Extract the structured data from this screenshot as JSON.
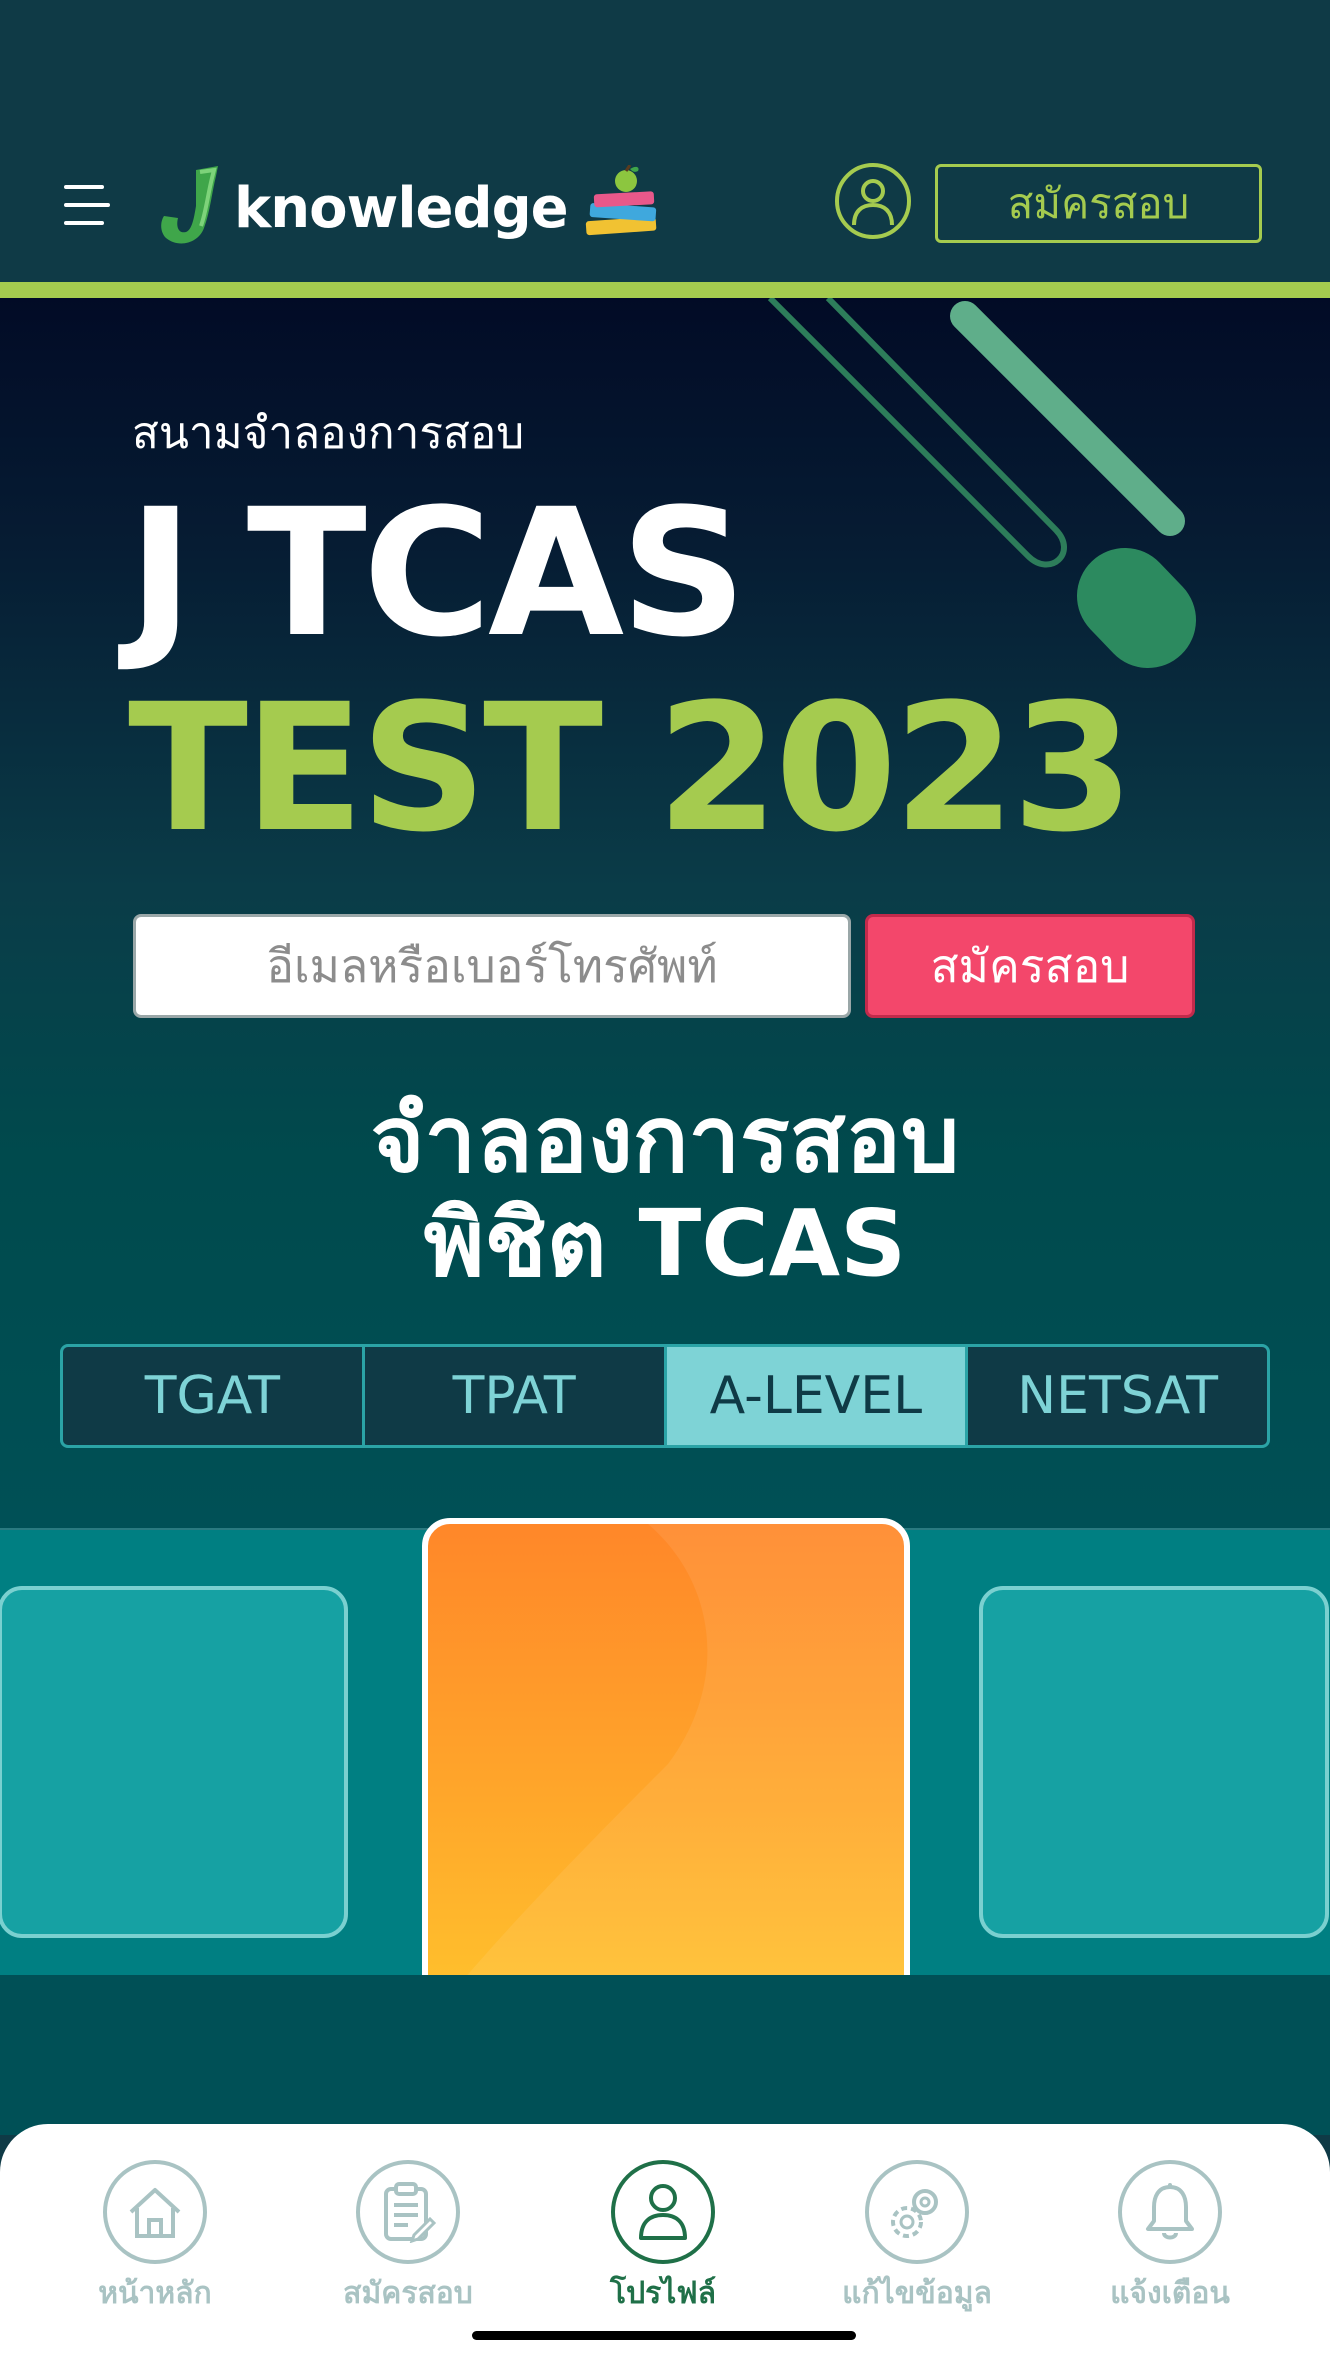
{
  "header": {
    "logo_text": "knowledge",
    "register_label": "สมัครสอบ",
    "accent_color": "#a5cb4f"
  },
  "hero": {
    "subtitle": "สนามจำลองการสอบ",
    "title_line1": "J TCAS",
    "title_line2": "TEST 2023",
    "email_placeholder": "อีเมลหรือเบอร์โทรศัพท์",
    "register_label": "สมัครสอบ",
    "headline_line1": "จำลองการสอบ",
    "headline_line2": "พิชิต TCAS"
  },
  "tabs": [
    {
      "label": "TGAT",
      "active": false
    },
    {
      "label": "TPAT",
      "active": false
    },
    {
      "label": "A-LEVEL",
      "active": true
    },
    {
      "label": "NETSAT",
      "active": false
    }
  ],
  "carousel": {
    "cards": [
      "left-card",
      "center-card",
      "right-card"
    ],
    "center_color": "#ffa52a"
  },
  "bottom_nav": [
    {
      "label": "หน้าหลัก",
      "icon": "home-icon",
      "active": false
    },
    {
      "label": "สมัครสอบ",
      "icon": "clipboard-icon",
      "active": false
    },
    {
      "label": "โปรไฟล์",
      "icon": "user-icon",
      "active": true
    },
    {
      "label": "แก้ไขข้อมูล",
      "icon": "gear-icon",
      "active": false
    },
    {
      "label": "แจ้งเตือน",
      "icon": "bell-icon",
      "active": false
    }
  ]
}
